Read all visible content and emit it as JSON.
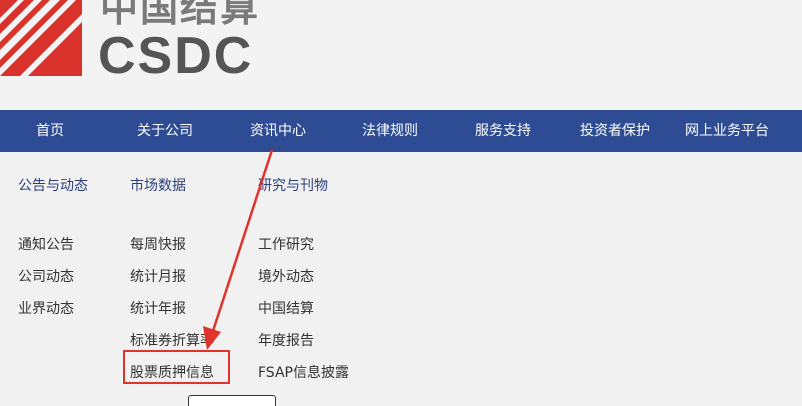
{
  "logo": {
    "cn_text": "中国结算",
    "en_text": "CSDC"
  },
  "nav": {
    "items": [
      {
        "label": "首页"
      },
      {
        "label": "关于公司"
      },
      {
        "label": "资讯中心"
      },
      {
        "label": "法律规则"
      },
      {
        "label": "服务支持"
      },
      {
        "label": "投资者保护"
      },
      {
        "label": "网上业务平台"
      }
    ]
  },
  "menu": {
    "columns": [
      {
        "heading": "公告与动态",
        "links": [
          "通知公告",
          "公司动态",
          "业界动态"
        ]
      },
      {
        "heading": "市场数据",
        "links": [
          "每周快报",
          "统计月报",
          "统计年报",
          "标准券折算率",
          "股票质押信息"
        ]
      },
      {
        "heading": "研究与刊物",
        "links": [
          "工作研究",
          "境外动态",
          "中国结算",
          "年度报告",
          "FSAP信息披露"
        ]
      }
    ]
  },
  "annotation": {
    "color": "#e0332b"
  }
}
